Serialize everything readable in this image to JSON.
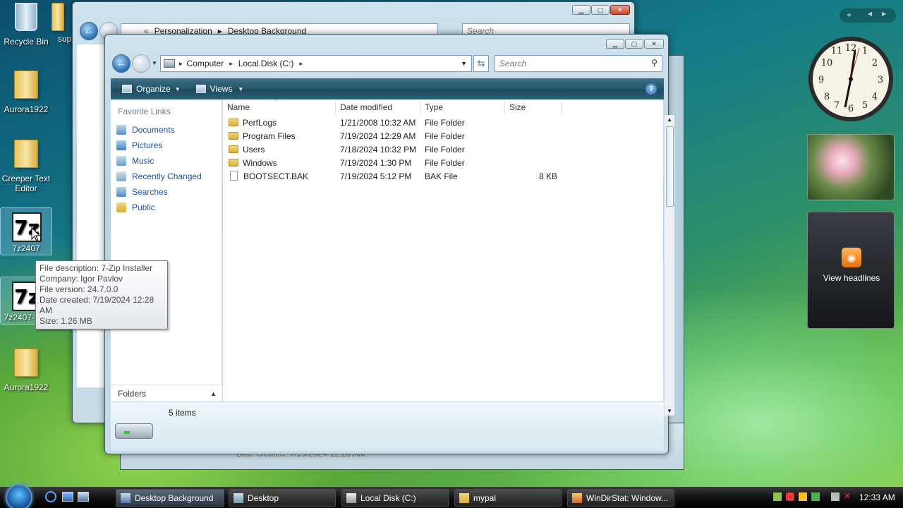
{
  "desktop": {
    "icons": [
      {
        "label": "Recycle Bin"
      },
      {
        "label": "sup"
      },
      {
        "label": "Aurora1922"
      },
      {
        "label": "Creeper Text Editor"
      },
      {
        "label": "7z2407"
      },
      {
        "label": "7z2407-x64"
      },
      {
        "label": "Aurora1922"
      }
    ]
  },
  "back_window": {
    "breadcrumb": [
      "Personalization",
      "Desktop Background"
    ],
    "search_placeholder": "Search",
    "ghost_text": "Date created: 7/19/2024 12:28 AM"
  },
  "explorer": {
    "breadcrumb": [
      "Computer",
      "Local Disk (C:)"
    ],
    "search_placeholder": "Search",
    "toolbar": {
      "organize": "Organize",
      "views": "Views",
      "help": "?"
    },
    "favorite_links_title": "Favorite Links",
    "favorite_links": [
      {
        "label": "Documents",
        "icon": "documents-icon"
      },
      {
        "label": "Pictures",
        "icon": "pictures-icon"
      },
      {
        "label": "Music",
        "icon": "music-icon"
      },
      {
        "label": "Recently Changed",
        "icon": "recent-icon"
      },
      {
        "label": "Searches",
        "icon": "search-folder-icon"
      },
      {
        "label": "Public",
        "icon": "public-folder-icon"
      }
    ],
    "folders_label": "Folders",
    "columns": [
      "Name",
      "Date modified",
      "Type",
      "Size"
    ],
    "rows": [
      {
        "name": "PerfLogs",
        "date": "1/21/2008 10:32 AM",
        "type": "File Folder",
        "size": "",
        "kind": "folder"
      },
      {
        "name": "Program Files",
        "date": "7/19/2024 12:29 AM",
        "type": "File Folder",
        "size": "",
        "kind": "folder"
      },
      {
        "name": "Users",
        "date": "7/18/2024 10:32 PM",
        "type": "File Folder",
        "size": "",
        "kind": "folder"
      },
      {
        "name": "Windows",
        "date": "7/19/2024 1:30 PM",
        "type": "File Folder",
        "size": "",
        "kind": "folder"
      },
      {
        "name": "BOOTSECT.BAK",
        "date": "7/19/2024 5:12 PM",
        "type": "BAK File",
        "size": "8 KB",
        "kind": "file"
      }
    ],
    "status": "5 items"
  },
  "tooltip": {
    "lines": [
      "File description: 7-Zip Installer",
      "Company: Igor Pavlov",
      "File version: 24.7.0.0",
      "Date created: 7/19/2024 12:28 AM",
      "Size: 1.26 MB"
    ]
  },
  "sidebar": {
    "feed_label": "View headlines",
    "add_button": "+"
  },
  "taskbar": {
    "buttons": [
      {
        "label": "Desktop Background"
      },
      {
        "label": "Desktop"
      },
      {
        "label": "Local Disk (C:)"
      },
      {
        "label": "mypal"
      },
      {
        "label": "WinDirStat: Window..."
      }
    ],
    "clock": "12:33 AM"
  },
  "colors": {
    "accent": "#245568",
    "link": "#1f4e9c",
    "taskbar": "#111111"
  }
}
